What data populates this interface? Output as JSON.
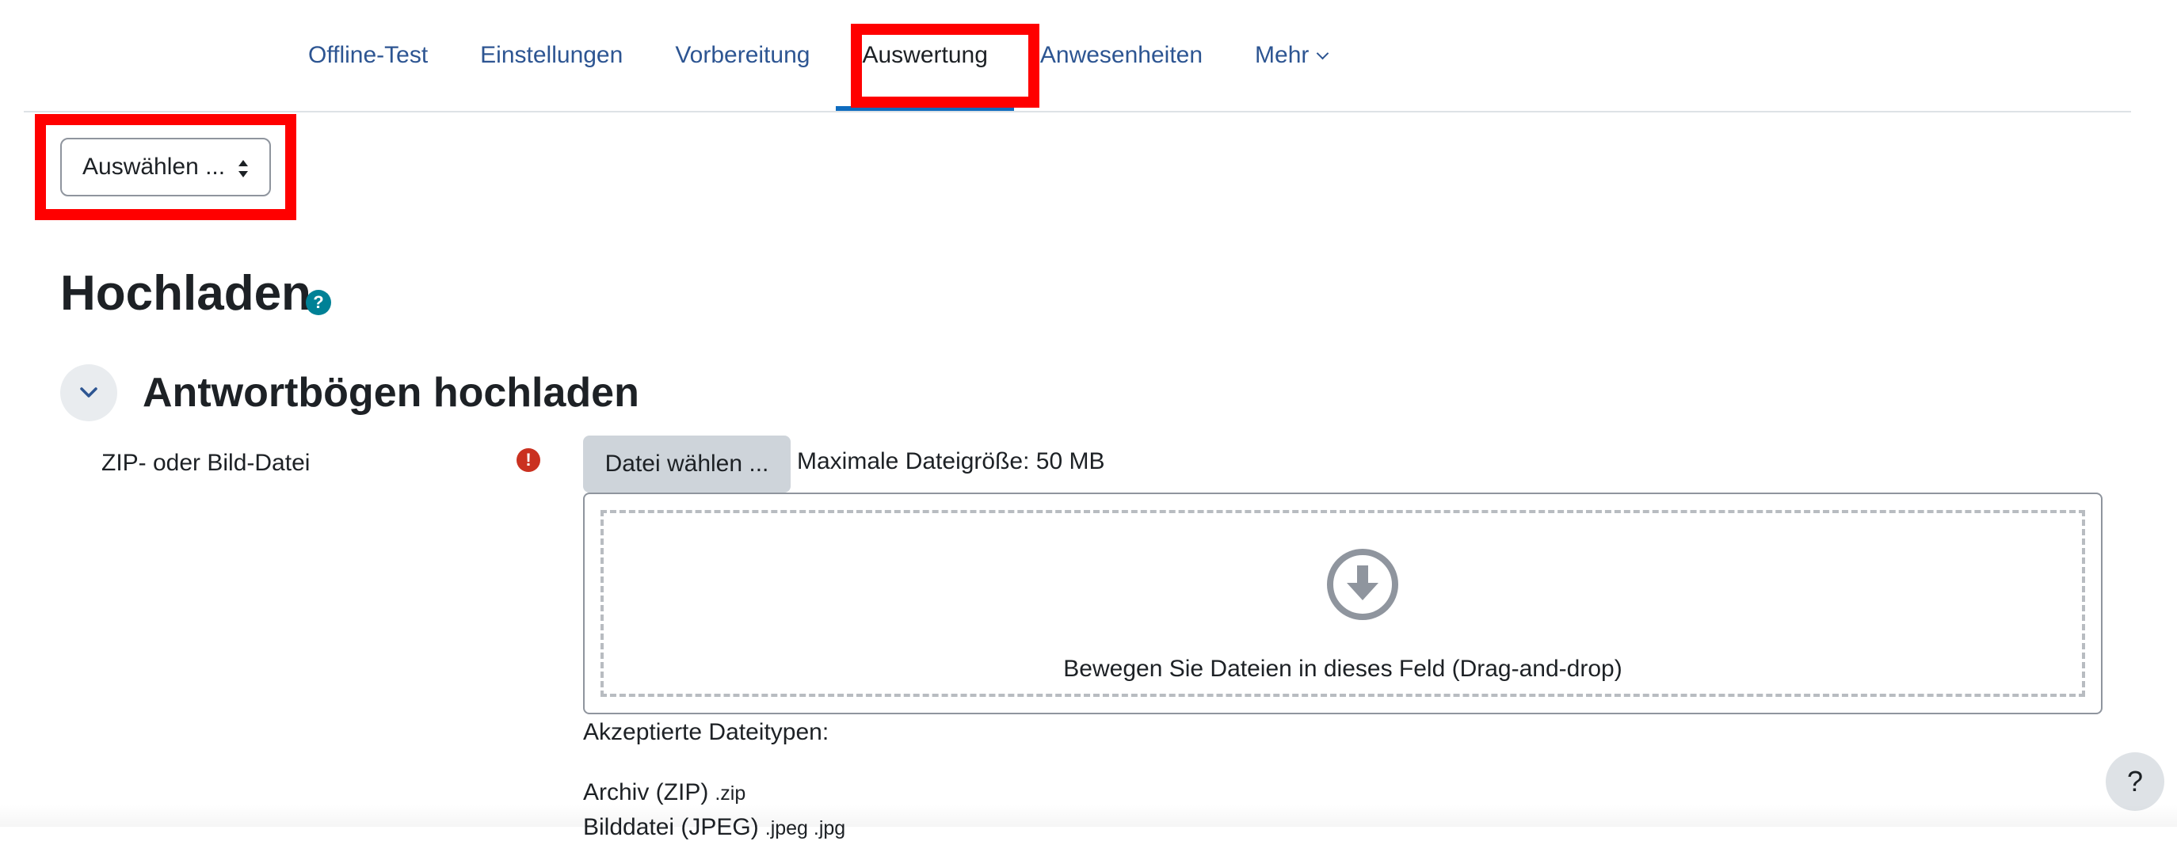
{
  "nav": {
    "items": [
      {
        "label": "Offline-Test"
      },
      {
        "label": "Einstellungen"
      },
      {
        "label": "Vorbereitung"
      },
      {
        "label": "Auswertung",
        "active": true
      },
      {
        "label": "Anwesenheiten"
      },
      {
        "label": "Mehr"
      }
    ]
  },
  "select": {
    "value": "Auswählen ..."
  },
  "page": {
    "title": "Hochladen",
    "help_icon": "?"
  },
  "section": {
    "title": "Antwortbögen hochladen"
  },
  "field": {
    "label": "ZIP- oder Bild-Datei",
    "required_icon": "!",
    "choose_button": "Datei wählen ...",
    "max_size": "Maximale Dateigröße: 50 MB",
    "dropzone_text": "Bewegen Sie Dateien in dieses Feld (Drag-and-drop)",
    "accepted_label": "Akzeptierte Dateitypen:",
    "types": [
      {
        "name": "Archiv (ZIP)",
        "ext": ".zip"
      },
      {
        "name": "Bilddatei (JPEG)",
        "ext": ".jpeg .jpg"
      }
    ]
  },
  "help_fab": "?",
  "colors": {
    "link": "#2d5592",
    "highlight": "#ff0000",
    "active_underline": "#0f6cbf",
    "required": "#ca3120",
    "help": "#008196"
  }
}
